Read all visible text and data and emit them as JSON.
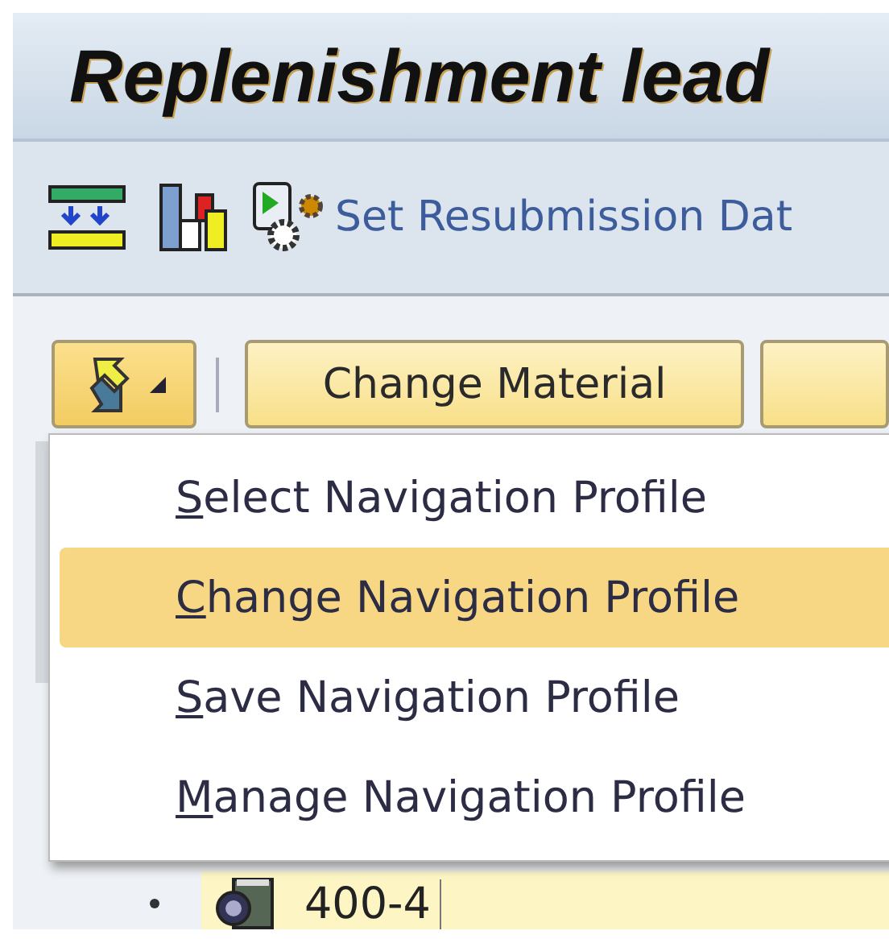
{
  "window": {
    "title": "Replenishment lead"
  },
  "toolbar": {
    "action_label": "Set Resubmission Dat"
  },
  "buttons": [
    {
      "kind": "menu"
    },
    {
      "kind": "text",
      "label": "Change Material"
    },
    {
      "kind": "blank"
    }
  ],
  "menu": {
    "items": [
      {
        "label": "Select Navigation Profile",
        "selected": false
      },
      {
        "label": "Change Navigation Profile",
        "selected": true
      },
      {
        "label": "Save Navigation Profile",
        "selected": false
      },
      {
        "label": "Manage Navigation Profile",
        "selected": false
      }
    ]
  },
  "tree": {
    "items": [
      {
        "label": "400-4",
        "selected": true
      }
    ]
  }
}
